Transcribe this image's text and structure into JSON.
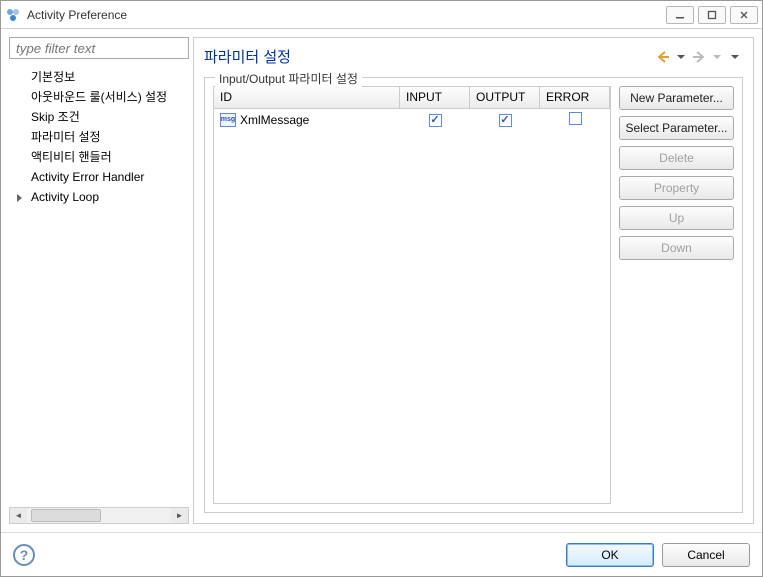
{
  "window": {
    "title": "Activity Preference"
  },
  "filter": {
    "placeholder": "type filter text"
  },
  "tree": {
    "items": [
      {
        "label": "기본정보",
        "hasChildren": false
      },
      {
        "label": "아웃바운드 룰(서비스) 설정",
        "hasChildren": false
      },
      {
        "label": "Skip 조건",
        "hasChildren": false
      },
      {
        "label": "파라미터 설정",
        "hasChildren": false,
        "selected": true
      },
      {
        "label": "액티비티 핸들러",
        "hasChildren": false
      },
      {
        "label": "Activity Error Handler",
        "hasChildren": false
      },
      {
        "label": "Activity Loop",
        "hasChildren": true
      }
    ]
  },
  "content": {
    "title": "파라미터 설정",
    "group_label": "Input/Output 파라미터 설정",
    "columns": {
      "id": "ID",
      "input": "INPUT",
      "output": "OUTPUT",
      "error": "ERROR"
    },
    "rows": [
      {
        "icon": "msg",
        "id": "XmlMessage",
        "input": true,
        "output": true,
        "error": false
      }
    ],
    "buttons": {
      "new_parameter": "New Parameter...",
      "select_parameter": "Select Parameter...",
      "delete": "Delete",
      "property": "Property",
      "up": "Up",
      "down": "Down"
    }
  },
  "footer": {
    "ok": "OK",
    "cancel": "Cancel"
  }
}
